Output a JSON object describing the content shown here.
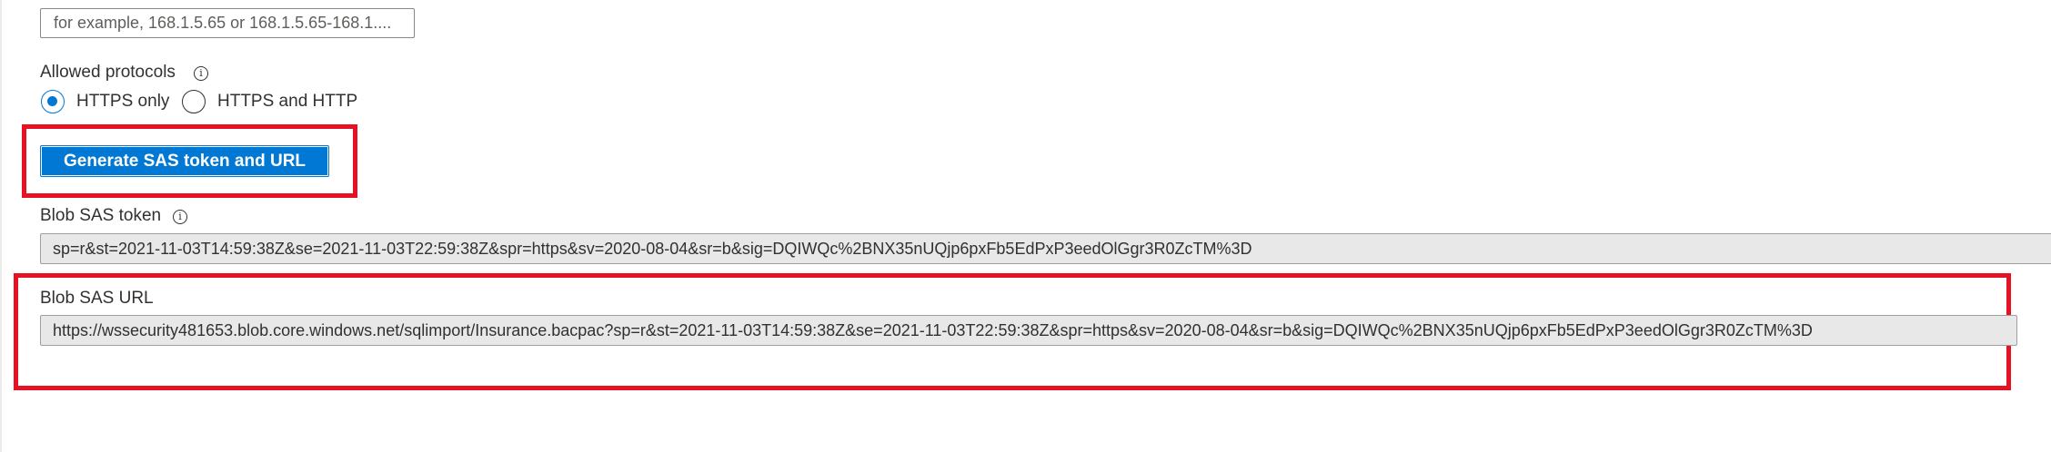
{
  "ip_address": {
    "placeholder": "for example, 168.1.5.65 or 168.1.5.65-168.1...."
  },
  "protocols": {
    "label": "Allowed protocols",
    "info_icon": "info-icon",
    "options": [
      {
        "label": "HTTPS only",
        "checked": true
      },
      {
        "label": "HTTPS and HTTP",
        "checked": false
      }
    ]
  },
  "generate_button": {
    "label": "Generate SAS token and URL"
  },
  "sas_token": {
    "label": "Blob SAS token",
    "info_icon": "info-icon",
    "value": "sp=r&st=2021-11-03T14:59:38Z&se=2021-11-03T22:59:38Z&spr=https&sv=2020-08-04&sr=b&sig=DQIWQc%2BNX35nUQjp6pxFb5EdPxP3eedOlGgr3R0ZcTM%3D"
  },
  "sas_url": {
    "label": "Blob SAS URL",
    "value": "https://wssecurity481653.blob.core.windows.net/sqlimport/Insurance.bacpac?sp=r&st=2021-11-03T14:59:38Z&se=2021-11-03T22:59:38Z&spr=https&sv=2020-08-04&sr=b&sig=DQIWQc%2BNX35nUQjp6pxFb5EdPxP3eedOlGgr3R0ZcTM%3D"
  },
  "colors": {
    "accent": "#0078d4",
    "highlight": "#e81123",
    "readonly_bg": "#e8e8e8"
  }
}
